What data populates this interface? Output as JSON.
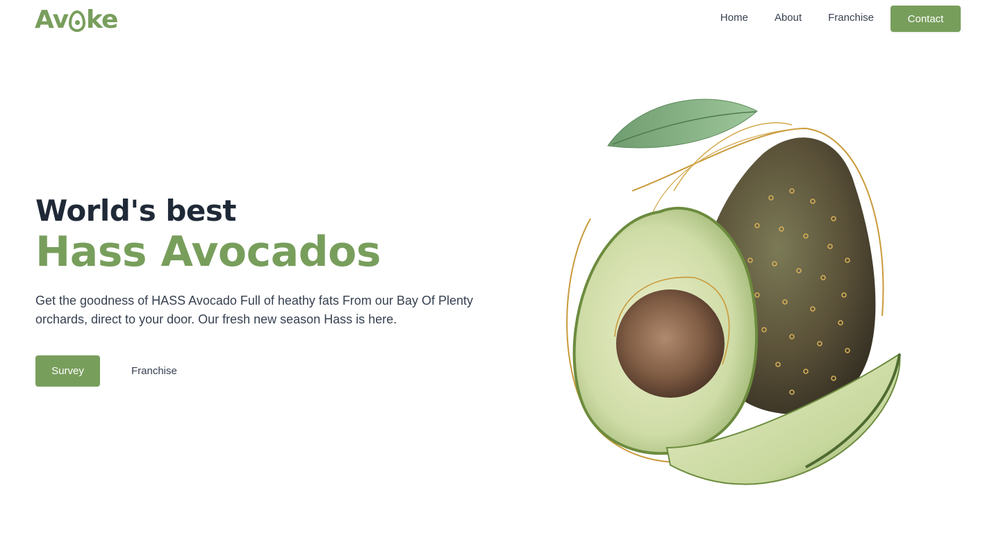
{
  "brand": {
    "logo_text_left": "Av",
    "logo_text_right": "ke"
  },
  "nav": {
    "links": [
      "Home",
      "About",
      "Franchise"
    ],
    "contact_label": "Contact"
  },
  "hero": {
    "headline_top": "World's best",
    "headline_bottom": "Hass Avocados",
    "subtitle": "Get the goodness of HASS Avocado Full of heathy fats From our Bay Of Plenty orchards, direct to your door. Our fresh new season Hass is here.",
    "primary_cta": "Survey",
    "secondary_cta": "Franchise"
  },
  "colors": {
    "accent": "#789e5c",
    "heading_dark": "#1f2937",
    "text": "#374151"
  },
  "illustration": {
    "icon": "avocado-illustration"
  }
}
